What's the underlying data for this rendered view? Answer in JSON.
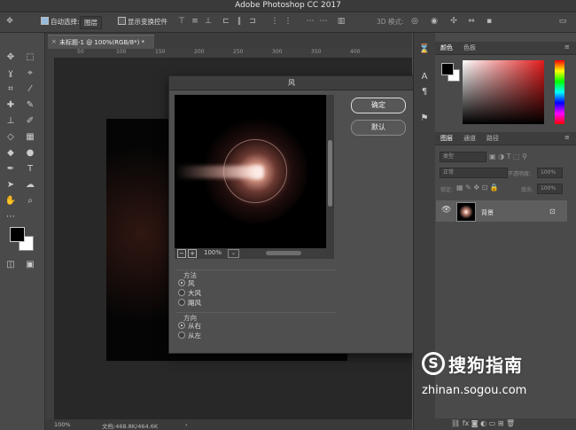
{
  "window": {
    "title": "Adobe Photoshop CC 2017"
  },
  "options": {
    "auto_select_label": "自动选择:",
    "auto_select_value": "图层",
    "show_transform_label": "显示变换控件",
    "mode_3d_label": "3D 模式:"
  },
  "document": {
    "tab_label": "未标题-1 @ 100%(RGB/8*) *",
    "ruler_numbers": [
      "50",
      "100",
      "150",
      "200",
      "250",
      "300",
      "350",
      "400"
    ],
    "zoom_status": "100%",
    "file_status": "文档:468.8K/464.6K"
  },
  "dialog": {
    "title": "风",
    "ok_label": "确定",
    "default_label": "默认",
    "preview_zoom": "100%",
    "method_label": "方法",
    "methods": [
      "风",
      "大风",
      "飓风"
    ],
    "method_selected": 0,
    "direction_label": "方向",
    "directions": [
      "从右",
      "从左"
    ],
    "direction_selected": 0
  },
  "panels": {
    "color_tabs": [
      "颜色",
      "色板"
    ],
    "layer_tabs": [
      "图层",
      "通道",
      "路径"
    ],
    "kind_filter": "类型",
    "blend_mode": "正常",
    "opacity_label": "不透明度:",
    "opacity_value": "100%",
    "lock_label": "锁定:",
    "fill_label": "填充:",
    "fill_value": "100%",
    "layer_name": "背景"
  },
  "watermark": {
    "brand": "搜狗指南",
    "url": "zhinan.sogou.com",
    "logo_glyph": "S"
  },
  "colors": {
    "accent_red": "#e21b1b",
    "dialog_bg": "#4f4f4f",
    "panel_bg": "#4a4a4a"
  }
}
